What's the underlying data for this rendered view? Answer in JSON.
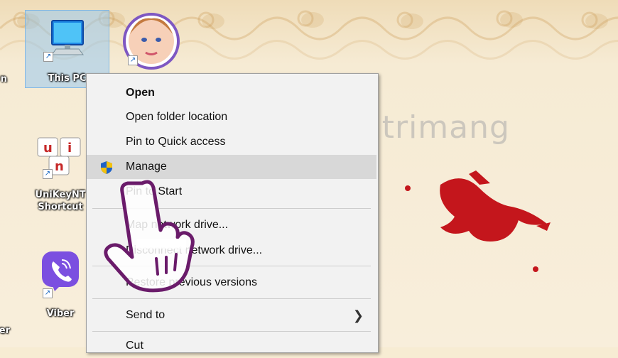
{
  "desktop": {
    "icons": [
      {
        "label": "This PC"
      },
      {
        "label": ""
      },
      {
        "label": "UniKeyNT",
        "label2": "Shortcut"
      },
      {
        "label": "Viber"
      }
    ],
    "edge_labels": [
      "n",
      "er"
    ]
  },
  "context_menu": {
    "items": [
      {
        "label": "Open"
      },
      {
        "label": "Open folder location"
      },
      {
        "label": "Pin to Quick access"
      },
      {
        "label": "Manage"
      },
      {
        "label": "Pin to Start"
      },
      {
        "label": "Map network drive..."
      },
      {
        "label": "Disconnect network drive..."
      },
      {
        "label": "Restore previous versions"
      },
      {
        "label": "Send to"
      },
      {
        "label": "Cut"
      }
    ]
  },
  "watermark": {
    "text": "uantrimang"
  },
  "icons": [
    "monitor-icon",
    "avatar-icon",
    "unikey-icon",
    "viber-icon",
    "shield-icon",
    "chevron-right-icon",
    "hand-cursor-icon",
    "bird-icon"
  ]
}
